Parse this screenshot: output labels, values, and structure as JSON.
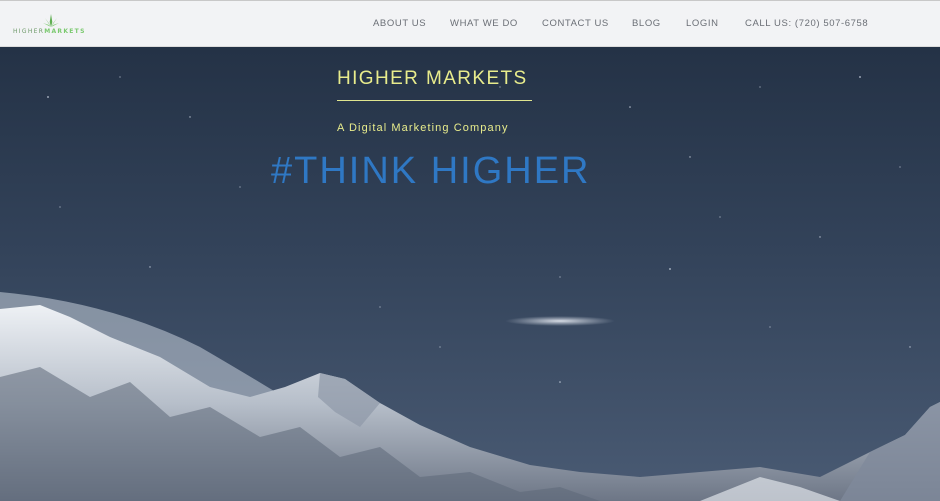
{
  "header": {
    "logo": {
      "word_light": "HIGHER",
      "word_bold": "MARKETS"
    },
    "nav": [
      {
        "label": "ABOUT US"
      },
      {
        "label": "WHAT WE DO"
      },
      {
        "label": "CONTACT US"
      },
      {
        "label": "BLOG"
      },
      {
        "label": "LOGIN"
      },
      {
        "label": "CALL US: (720) 507-6758"
      }
    ]
  },
  "hero": {
    "title": "HIGHER MARKETS",
    "tagline": "A Digital Marketing Company",
    "headline": "#THINK HIGHER"
  },
  "colors": {
    "title_yellow": "#e8ec8c",
    "headline_blue": "#2f78c4",
    "nav_text": "#6b6f76",
    "header_bg": "#f2f3f5",
    "logo_green": "#7bc96f"
  },
  "icons": {
    "logo_mark": "leaf-icon"
  }
}
